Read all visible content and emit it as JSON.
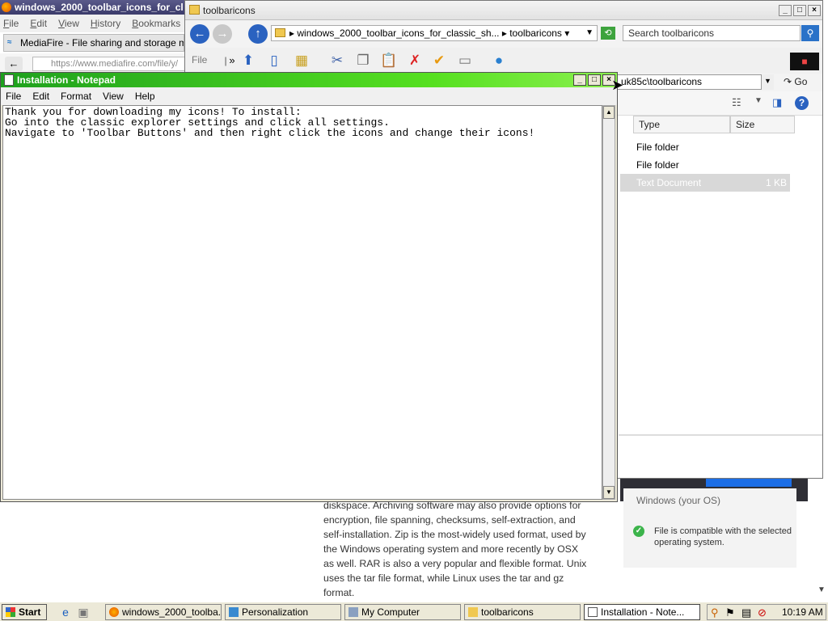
{
  "browser": {
    "title": "windows_2000_toolbar_icons_for_cl",
    "menu": [
      "File",
      "Edit",
      "View",
      "History",
      "Bookmarks"
    ],
    "tab_title": "MediaFire - File sharing and storage mad...",
    "url": "https://www.mediafire.com/file/y/",
    "page_text": "diskspace. Archiving software may also provide options for encryption, file spanning, checksums, self-extraction, and self-installation. Zip is the most-widely used format, used by the Windows operating system and more recently by OSX as well. RAR is also a very popular and flexible format. Unix uses the tar file format, while Linux uses the tar and gz format.",
    "os_select": "Windows (your OS)",
    "compat_msg": "File is compatible with the selected operating system."
  },
  "explorer": {
    "title": "toolbaricons",
    "breadcrumb": [
      "windows_2000_toolbar_icons_for_classic_sh...",
      "toolbaricons"
    ],
    "search_placeholder": "Search toolbaricons",
    "file_label": "File",
    "address": "uk85c\\toolbaricons",
    "go_label": "Go",
    "columns": [
      "Type",
      "Size"
    ],
    "rows": [
      {
        "type": "File folder",
        "size": ""
      },
      {
        "type": "File folder",
        "size": ""
      },
      {
        "type": "Text Document",
        "size": "1 KB"
      }
    ]
  },
  "notepad": {
    "title": "Installation - Notepad",
    "menu": [
      "File",
      "Edit",
      "Format",
      "View",
      "Help"
    ],
    "content": "Thank you for downloading my icons! To install:\nGo into the classic explorer settings and click all settings.\nNavigate to 'Toolbar Buttons' and then right click the icons and change their icons!"
  },
  "taskbar": {
    "start_label": "Start",
    "tasks": [
      "windows_2000_toolba...",
      "Personalization",
      "My Computer",
      "toolbaricons",
      "Installation - Note..."
    ],
    "clock": "10:19 AM"
  }
}
